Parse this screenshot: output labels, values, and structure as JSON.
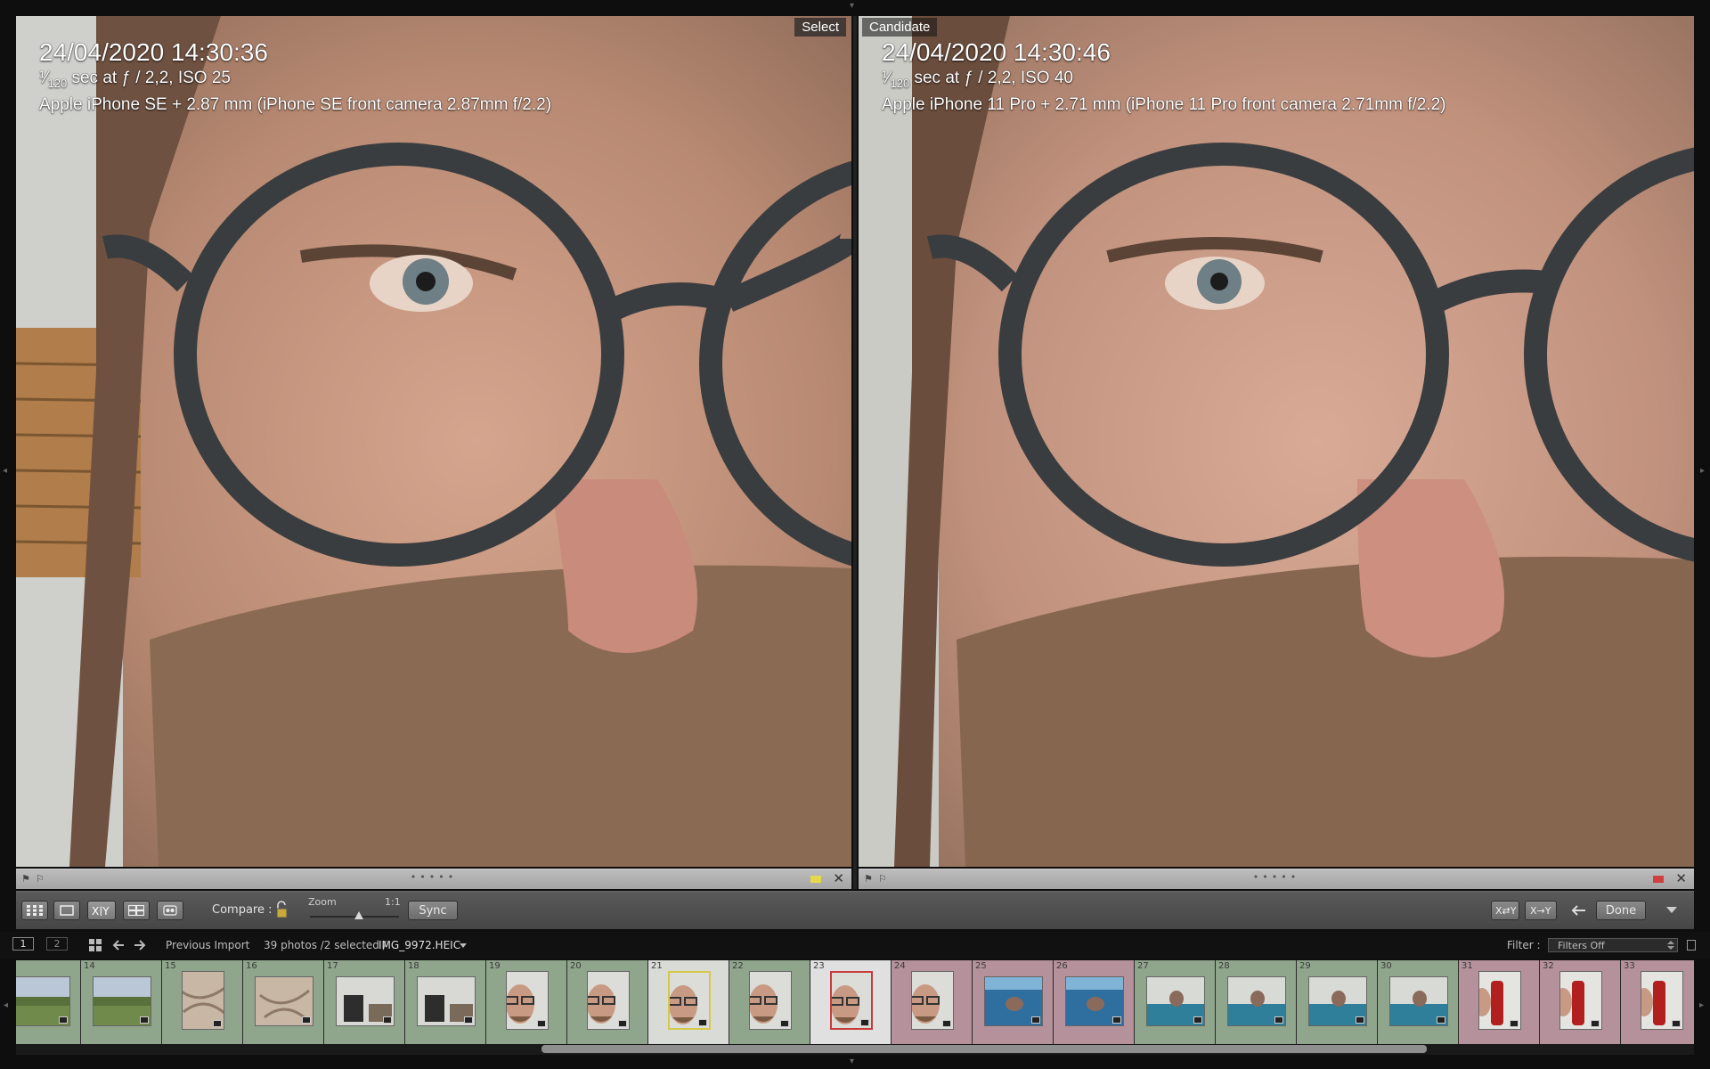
{
  "compare": {
    "select": {
      "tag": "Select",
      "date": "24/04/2020 14:30:36",
      "exposure_prefix": "¹⁄",
      "exposure_sub": "120",
      "exposure_rest": " sec at ƒ / 2,2, ISO 25",
      "camera": "Apple iPhone SE + 2.87 mm (iPhone SE front camera 2.87mm f/2.2)"
    },
    "candidate": {
      "tag": "Candidate",
      "date": "24/04/2020 14:30:46",
      "exposure_prefix": "¹⁄",
      "exposure_sub": "120",
      "exposure_rest": " sec at ƒ / 2,2, ISO 40",
      "camera": "Apple iPhone 11 Pro + 2.71 mm (iPhone 11 Pro front camera 2.71mm f/2.2)"
    },
    "left_label_color": "#e6d84a",
    "right_label_color": "#d04040"
  },
  "toolbar": {
    "compare_label": "Compare :",
    "zoom_label": "Zoom",
    "zoom_value": "1:1",
    "sync_label": "Sync",
    "done_label": "Done"
  },
  "filmstrip_header": {
    "monitor1": "1",
    "monitor2": "2",
    "source": "Previous Import",
    "count": "39 photos /2 selected /",
    "filename": "IMG_9972.HEIC",
    "filter_label": "Filter :",
    "filter_value": "Filters Off"
  },
  "filmstrip": {
    "cells": [
      {
        "num": "",
        "bg": "#8fa58c",
        "kind": "landscape",
        "scene": "field"
      },
      {
        "num": "14",
        "bg": "#8fa58c",
        "kind": "landscape",
        "scene": "field"
      },
      {
        "num": "15",
        "bg": "#8fa58c",
        "kind": "portrait",
        "scene": "fabric"
      },
      {
        "num": "16",
        "bg": "#8fa58c",
        "kind": "landscape",
        "scene": "fabric"
      },
      {
        "num": "17",
        "bg": "#8fa58c",
        "kind": "landscape",
        "scene": "room"
      },
      {
        "num": "18",
        "bg": "#8fa58c",
        "kind": "landscape",
        "scene": "room"
      },
      {
        "num": "19",
        "bg": "#8fa58c",
        "kind": "portrait",
        "scene": "face"
      },
      {
        "num": "20",
        "bg": "#8fa58c",
        "kind": "portrait",
        "scene": "face"
      },
      {
        "num": "21",
        "bg": "#d9dcd6",
        "kind": "portrait",
        "scene": "face",
        "border": "#d6c84a"
      },
      {
        "num": "22",
        "bg": "#8fa58c",
        "kind": "portrait",
        "scene": "face"
      },
      {
        "num": "23",
        "bg": "#e0e0e0",
        "kind": "portrait",
        "scene": "face",
        "border": "#c83c3c"
      },
      {
        "num": "24",
        "bg": "#b4919b",
        "kind": "portrait",
        "scene": "face"
      },
      {
        "num": "25",
        "bg": "#b4919b",
        "kind": "landscape",
        "scene": "pool"
      },
      {
        "num": "26",
        "bg": "#b4919b",
        "kind": "landscape",
        "scene": "pool"
      },
      {
        "num": "27",
        "bg": "#8fa58c",
        "kind": "landscape",
        "scene": "sofa"
      },
      {
        "num": "28",
        "bg": "#8fa58c",
        "kind": "landscape",
        "scene": "sofa"
      },
      {
        "num": "29",
        "bg": "#8fa58c",
        "kind": "landscape",
        "scene": "sofa"
      },
      {
        "num": "30",
        "bg": "#8fa58c",
        "kind": "landscape",
        "scene": "sofa"
      },
      {
        "num": "31",
        "bg": "#b4919b",
        "kind": "portrait",
        "scene": "bottle"
      },
      {
        "num": "32",
        "bg": "#b4919b",
        "kind": "portrait",
        "scene": "bottle"
      },
      {
        "num": "33",
        "bg": "#b4919b",
        "kind": "portrait",
        "scene": "bottle"
      }
    ]
  }
}
